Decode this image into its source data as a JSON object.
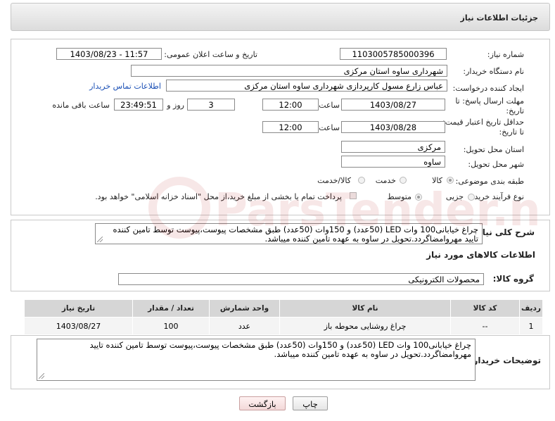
{
  "header": {
    "title": "جزئیات اطلاعات نیاز"
  },
  "form": {
    "need_number_label": "شماره نیاز:",
    "need_number": "1103005785000396",
    "announce_label": "تاریخ و ساعت اعلان عمومی:",
    "announce_value": "1403/08/23 - 11:57",
    "buyer_org_label": "نام دستگاه خریدار:",
    "buyer_org": "شهرداری ساوه استان مرکزی",
    "creator_label": "ایجاد کننده درخواست:",
    "creator": "عباس زارع مسول کارپردازی شهرداری ساوه استان مرکزی",
    "contact_link": "اطلاعات تماس خریدار",
    "reply_deadline_label": "مهلت ارسال پاسخ: تا تاریخ:",
    "reply_date": "1403/08/27",
    "time_label": "ساعت",
    "reply_time": "12:00",
    "days_value": "3",
    "days_and_label": "روز و",
    "remaining_time": "23:49:51",
    "remaining_label": "ساعت باقی مانده",
    "price_validity_label": "حداقل تاریخ اعتبار قیمت: تا تاریخ:",
    "price_date": "1403/08/28",
    "price_time_label": "ساعت",
    "price_time": "12:00",
    "province_label": "استان محل تحویل:",
    "province": "مرکزی",
    "city_label": "شهر محل تحویل:",
    "city": "ساوه",
    "category_label": "طبقه بندی موضوعی:",
    "category_options": [
      "کالا",
      "خدمت",
      "کالا/خدمت"
    ],
    "category_selected": "کالا",
    "process_label": "نوع فرآیند خرید :",
    "process_options": [
      "جزیی",
      "متوسط"
    ],
    "process_selected": "متوسط",
    "payment_note": "پرداخت تمام یا بخشی از مبلغ خرید،از محل \"اسناد خزانه اسلامی\" خواهد بود."
  },
  "description": {
    "label": "شرح کلی نیاز:",
    "text": "چراغ خیابانی100 وات LED (50عدد) و 150وات (50عدد) طبق مشخصات پیوست،پیوست توسط تامین کننده تایید مهروامضاگردد.تحویل در ساوه به عهده تامین کننده میباشد."
  },
  "goods": {
    "section_title": "اطلاعات کالاهای مورد نیاز",
    "group_label": "گروه کالا:",
    "group_value": "محصولات الکترونیکی",
    "columns": [
      "ردیف",
      "کد کالا",
      "نام کالا",
      "واحد شمارش",
      "تعداد / مقدار",
      "تاریخ نیاز"
    ],
    "rows": [
      {
        "row": "1",
        "code": "--",
        "name": "چراغ روشنایی محوطه باز",
        "unit": "عدد",
        "qty": "100",
        "date": "1403/08/27"
      }
    ]
  },
  "buyer_notes": {
    "label": "توضیحات خریدار:",
    "text": "چراغ خیابانی100 وات LED (50عدد) و 150وات (50عدد) طبق مشخصات پیوست،پیوست توسط تامین کننده تایید مهروامضاگردد.تحویل در ساوه به عهده تامین کننده میباشد."
  },
  "buttons": {
    "print": "چاپ",
    "back": "بازگشت"
  },
  "watermark": {
    "text": "ParsTender.net"
  },
  "colors": {
    "link": "#1a4fb5",
    "watermark": "#b00000"
  }
}
